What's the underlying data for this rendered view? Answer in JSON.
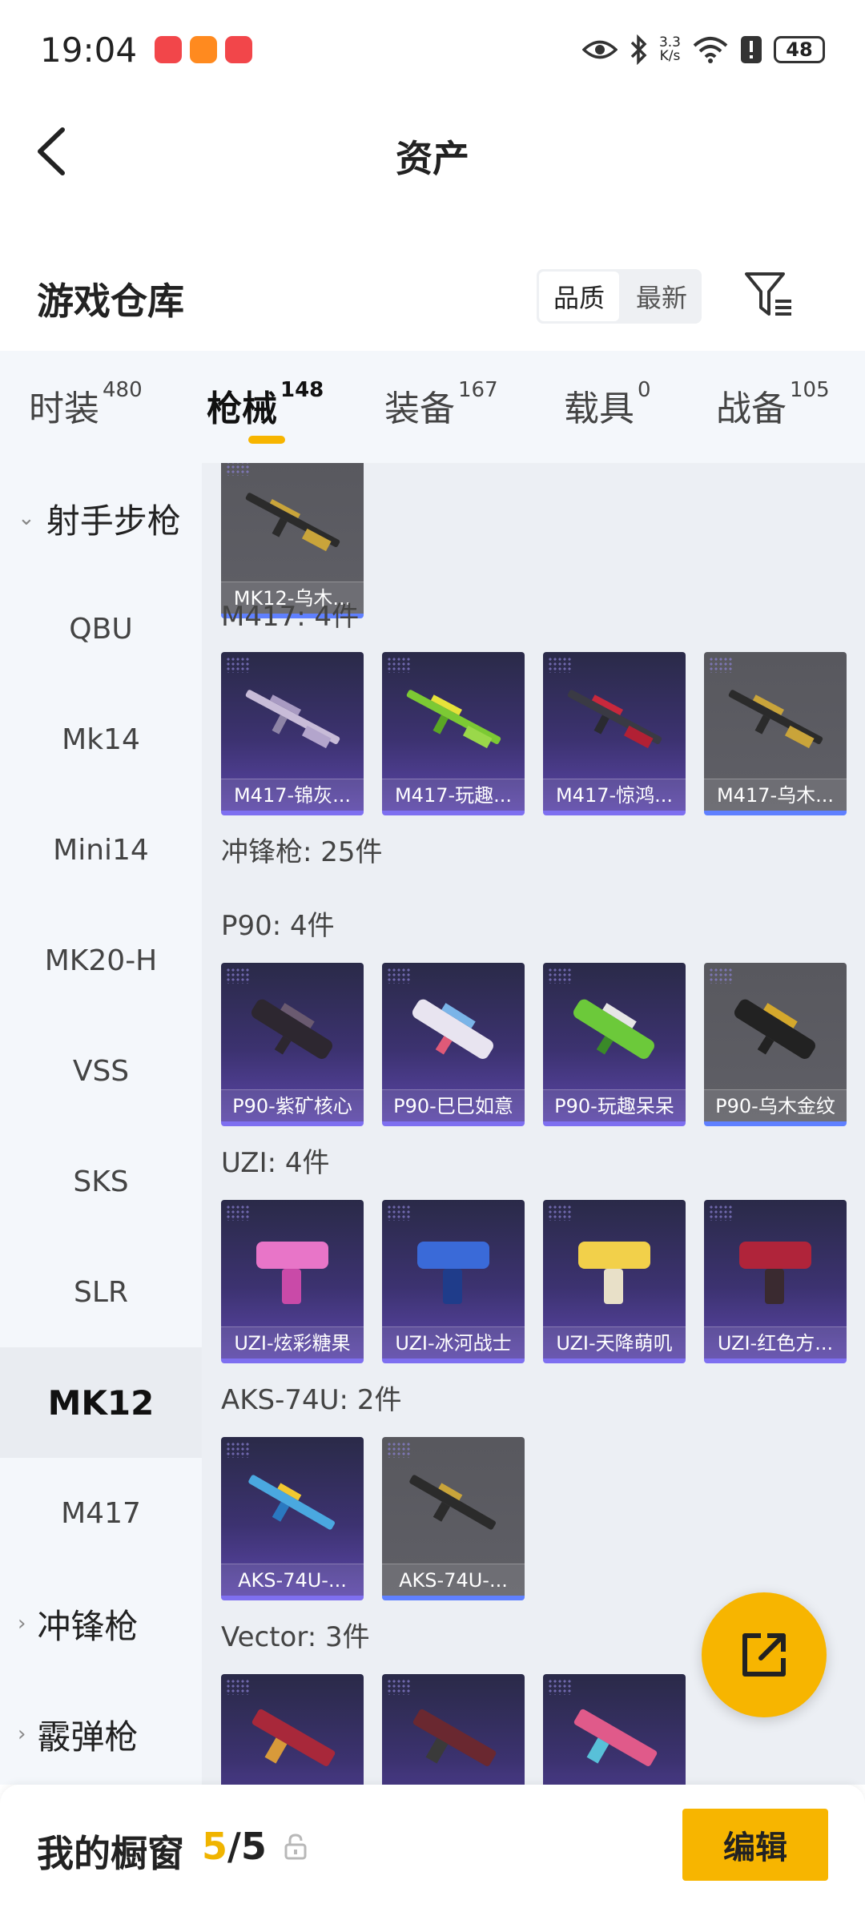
{
  "status_bar": {
    "time": "19:04",
    "net_speed_top": "3.3",
    "net_speed_bottom": "K/s",
    "battery": "48"
  },
  "header": {
    "title": "资产"
  },
  "warehouse": {
    "title": "游戏仓库",
    "sort_options": [
      "品质",
      "最新"
    ],
    "active_sort": "品质"
  },
  "tabs": [
    {
      "label": "时装",
      "count": "480"
    },
    {
      "label": "枪械",
      "count": "148",
      "active": true
    },
    {
      "label": "装备",
      "count": "167"
    },
    {
      "label": "载具",
      "count": "0"
    },
    {
      "label": "战备",
      "count": "105"
    }
  ],
  "sidebar": {
    "group_marksman": "射手步枪",
    "items": [
      "QBU",
      "Mk14",
      "Mini14",
      "MK20-H",
      "VSS",
      "SKS",
      "SLR",
      "MK12",
      "M417"
    ],
    "selected": "MK12",
    "group_smg": "冲锋枪",
    "group_shotgun": "霰弹枪"
  },
  "content": {
    "mk12_cards": [
      {
        "name": "MK12-乌木...",
        "style": "gray"
      }
    ],
    "m417_label": "M417: 4件",
    "m417_cards": [
      {
        "name": "M417-锦灰...",
        "style": "purple"
      },
      {
        "name": "M417-玩趣...",
        "style": "purple"
      },
      {
        "name": "M417-惊鸿...",
        "style": "purple"
      },
      {
        "name": "M417-乌木...",
        "style": "gray"
      }
    ],
    "smg_label": "冲锋枪: 25件",
    "p90_label": "P90: 4件",
    "p90_cards": [
      {
        "name": "P90-紫矿核心",
        "style": "purple"
      },
      {
        "name": "P90-巳巳如意",
        "style": "purple"
      },
      {
        "name": "P90-玩趣呆呆",
        "style": "purple"
      },
      {
        "name": "P90-乌木金纹",
        "style": "gray"
      }
    ],
    "uzi_label": "UZI: 4件",
    "uzi_cards": [
      {
        "name": "UZI-炫彩糖果",
        "style": "purple"
      },
      {
        "name": "UZI-冰河战士",
        "style": "purple"
      },
      {
        "name": "UZI-天降萌叽",
        "style": "purple"
      },
      {
        "name": "UZI-红色方...",
        "style": "purple"
      }
    ],
    "aks_label": "AKS-74U: 2件",
    "aks_cards": [
      {
        "name": "AKS-74U-...",
        "style": "purple"
      },
      {
        "name": "AKS-74U-...",
        "style": "gray"
      }
    ],
    "vector_label": "Vector: 3件"
  },
  "bottom_bar": {
    "label": "我的橱窗",
    "used": "5",
    "separator": "/",
    "total": "5",
    "edit_label": "编辑"
  },
  "colors": {
    "accent": "#f7b500",
    "card_purple": "#3c3270",
    "card_gray": "#5f5f66"
  }
}
